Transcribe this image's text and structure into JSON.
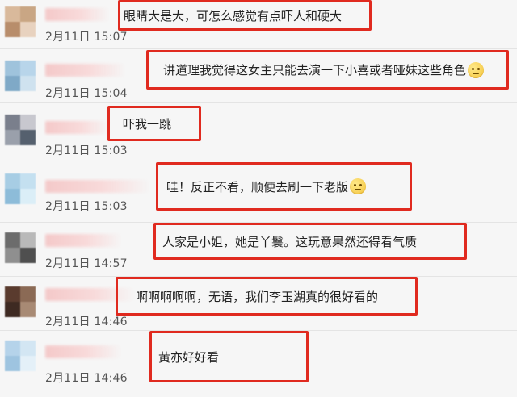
{
  "comments": [
    {
      "time": "2月11日 15:07",
      "text": "眼睛大是大，可怎么感觉有点吓人和硬大",
      "emoji": "",
      "avatar": [
        "#d9b99b",
        "#c9a684",
        "#b88d6b",
        "#e8d2bf"
      ]
    },
    {
      "time": "2月11日 15:04",
      "text": "讲道理我觉得这女主只能去演一下小喜或者哑妹这些角色",
      "emoji": "thinking-face-icon",
      "avatar": [
        "#9fc3dc",
        "#b8d5ea",
        "#7fa9c7",
        "#cfe2ef"
      ]
    },
    {
      "time": "2月11日 15:03",
      "text": "吓我一跳",
      "emoji": "",
      "avatar": [
        "#7a7f8c",
        "#c8c8cf",
        "#9aa0ab",
        "#55606e"
      ]
    },
    {
      "time": "2月11日 15:03",
      "text": "哇！反正不看，顺便去刷一下老版",
      "emoji": "thinking-face-icon",
      "avatar": [
        "#a7cde4",
        "#c4e0f0",
        "#8dbcd9",
        "#dbeef7"
      ]
    },
    {
      "time": "2月11日 14:57",
      "text": "人家是小姐，她是丫鬟。这玩意果然还得看气质",
      "emoji": "",
      "avatar": [
        "#6c6c6c",
        "#b9b9b9",
        "#8f8f8f",
        "#4f4f4f"
      ]
    },
    {
      "time": "2月11日 14:46",
      "text": "啊啊啊啊啊，无语，我们李玉湖真的很好看的",
      "emoji": "",
      "avatar": [
        "#5a3b2e",
        "#8b6a55",
        "#3e2a22",
        "#a88a74"
      ]
    },
    {
      "time": "2月11日 14:46",
      "text": "黄亦好好看",
      "emoji": "",
      "avatar": [
        "#b5d3ea",
        "#d3e6f3",
        "#9ec4e0",
        "#e4f0f8"
      ]
    }
  ]
}
